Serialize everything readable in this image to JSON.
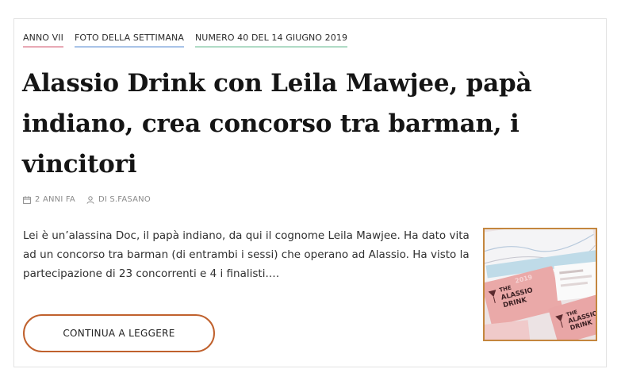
{
  "categories": [
    {
      "label": "ANNO VII",
      "accent": "#e8a9b5"
    },
    {
      "label": "FOTO DELLA SETTIMANA",
      "accent": "#a9c4e8"
    },
    {
      "label": "NUMERO 40 DEL 14 GIUGNO 2019",
      "accent": "#b0dcc6"
    }
  ],
  "article": {
    "title": "Alassio Drink con Leila Mawjee, papà indiano, crea concorso tra barman, i vincitori",
    "date": "2 ANNI FA",
    "author": "DI S.FASANO",
    "excerpt": "Lei è un’alassina Doc, il papà indiano, da qui il cognome Leila Mawjee. Ha dato vita ad un concorso tra barman (di entrambi i sessi) che operano ad Alassio. Ha visto la partecipazione di 23 concorrenti e 4 i finalisti.…",
    "read_more": "CONTINUA A LEGGERE",
    "thumbnail": {
      "card_text_1": "THE ALASSIO DRINK",
      "card_year": "2019",
      "card_text_2": "THE ALASSIO DRINK"
    }
  },
  "colors": {
    "button_border": "#c0612d",
    "thumbnail_border": "#c4863e",
    "card_pink": "#e9a6a6"
  }
}
